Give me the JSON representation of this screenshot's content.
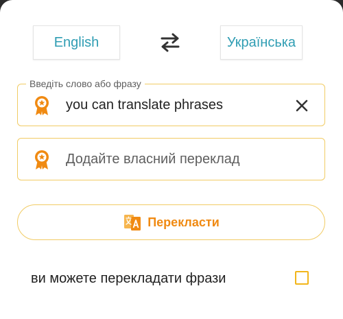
{
  "languages": {
    "source": "English",
    "target": "Українська"
  },
  "source_field": {
    "label": "Введіть слово або фразу",
    "value": "you can translate phrases"
  },
  "custom_field": {
    "placeholder": "Додайте власний переклад"
  },
  "translate_button": {
    "label": "Перекласти"
  },
  "result": {
    "text": "ви можете перекладати фрази",
    "checked": false
  },
  "icons": {
    "swap": "swap-arrows-icon",
    "source_field": "ribbon-badge-icon",
    "custom_field": "ribbon-badge-icon",
    "clear": "close-icon",
    "translate": "translate-icon"
  },
  "colors": {
    "accent_teal": "#2f9db3",
    "accent_orange": "#f08a12",
    "field_border": "#f1cb63",
    "checkbox": "#f2b51a"
  }
}
